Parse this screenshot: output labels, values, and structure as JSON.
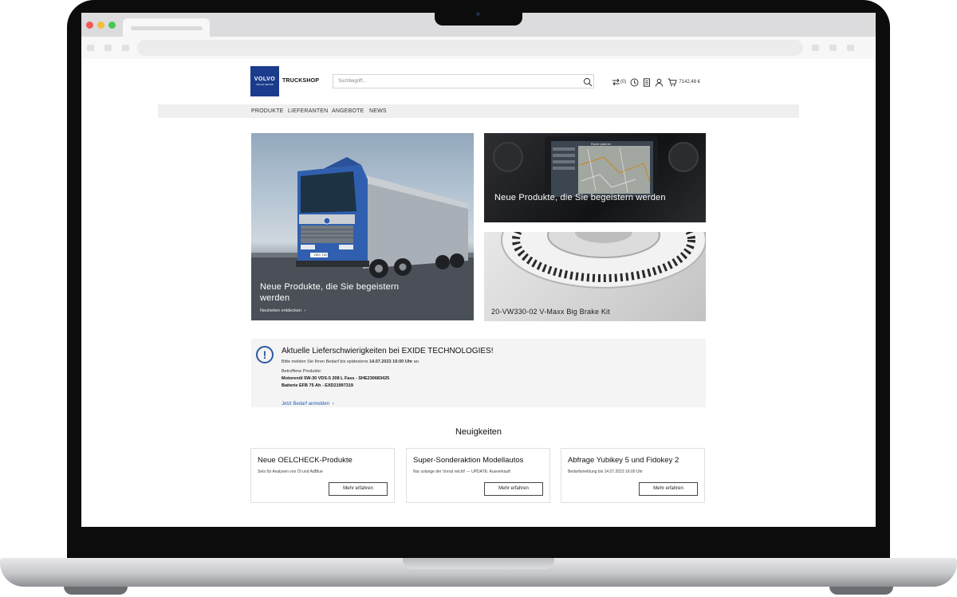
{
  "header": {
    "logo_text": "VOLVO",
    "logo_sub": "VOLVO GROUP",
    "brand": "TRUCKSHOP",
    "search_placeholder": "Suchbegriff...",
    "compare_count": "(0)",
    "cart_total": "7142,48 €"
  },
  "nav": {
    "items": [
      "PRODUKTE",
      "LIEFERANTEN",
      "ANGEBOTE",
      "NEWS"
    ]
  },
  "hero": {
    "main": {
      "title": "Neue Produkte, die Sie begeistern werden",
      "link": "Neuheiten entdecken"
    },
    "tile_top": {
      "title": "Neue Produkte, die Sie begeistern werden",
      "screen_label": "Route planner"
    },
    "tile_bottom": {
      "title": "20-VW330-02 V-Maxx Big Brake Kit"
    },
    "truck_plate": "DEC 192"
  },
  "notice": {
    "title": "Aktuelle Lieferschwierigkeiten bei EXIDE TECHNOLOGIES!",
    "line1_prefix": "Bitte melden Sie Ihren Bedarf bis spätestens",
    "line1_date": "14.07.2023 16:00 Uhr",
    "line1_suffix": "an.",
    "products_label": "Betroffene Produkte:",
    "product1": "Motorenöl 5W-30 VDS-5 208 L Fass - SHE230683425",
    "product2": "Batterie EFB 75 Ah - EXD21997319",
    "link": "Jetzt Bedarf anmelden"
  },
  "news": {
    "heading": "Neuigkeiten",
    "cards": [
      {
        "title": "Neue OELCHECK-Produkte",
        "subtitle": "Sets für Analysen von Öl und AdBlue",
        "button": "Mehr erfahren"
      },
      {
        "title": "Super-Sonderaktion Modellautos",
        "subtitle": "Nur solange der Vorrat reicht! --- UPDATE: Ausverkauft",
        "button": "Mehr erfahren"
      },
      {
        "title": "Abfrage Yubikey 5 und Fidokey 2",
        "subtitle": "Bedarfsmeldung bis 14.07.2023 16:00 Uhr",
        "button": "Mehr erfahren"
      }
    ]
  },
  "colors": {
    "brand_blue": "#1b3c8c",
    "link_blue": "#1b5fb8",
    "nav_bg": "#efefef",
    "notice_bg": "#f4f4f4"
  },
  "icons": [
    "search-icon",
    "compare-icon",
    "history-icon",
    "notepad-icon",
    "user-icon",
    "cart-icon",
    "exclamation-icon",
    "chevron-right-icon"
  ]
}
